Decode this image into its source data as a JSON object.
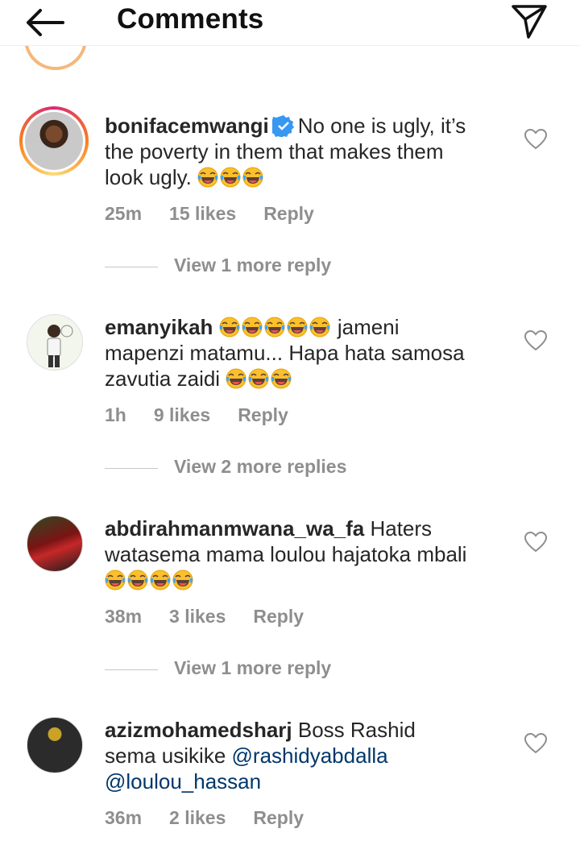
{
  "header": {
    "title": "Comments"
  },
  "comments": [
    {
      "username": "bonifacemwangi",
      "verified": true,
      "text_parts": [
        "No one is ugly, it’s",
        "the poverty in them that makes them",
        "look ugly."
      ],
      "emoji_count": 3,
      "time": "25m",
      "likes": "15 likes",
      "reply": "Reply",
      "more_replies": "View 1 more reply"
    },
    {
      "username": "emanyikah",
      "text_parts": [
        "jameni",
        "mapenzi matamu... Hapa hata samosa",
        "zavutia zaidi"
      ],
      "emoji_count_start": 5,
      "emoji_count_end": 3,
      "time": "1h",
      "likes": "9 likes",
      "reply": "Reply",
      "more_replies": "View 2 more replies"
    },
    {
      "username": "abdirahmanmwana_wa_fa",
      "text_parts": [
        "Haters",
        "watasema mama loulou hajatoka mbali"
      ],
      "emoji_count": 4,
      "time": "38m",
      "likes": "3 likes",
      "reply": "Reply",
      "more_replies": "View 1 more reply"
    },
    {
      "username": "azizmohamedsharj",
      "text_parts": [
        "Boss Rashid",
        "sema usikike"
      ],
      "mentions": [
        "@rashidyabdalla",
        "@loulou_hassan"
      ],
      "time": "36m",
      "likes": "2 likes",
      "reply": "Reply"
    }
  ],
  "icons": [
    "back-arrow-icon",
    "send-icon",
    "verified-badge-icon",
    "heart-icon",
    "laughing-emoji-icon"
  ],
  "colors": {
    "mention": "#00376b",
    "meta": "#8e8e8e",
    "verified": "#3897f0"
  }
}
